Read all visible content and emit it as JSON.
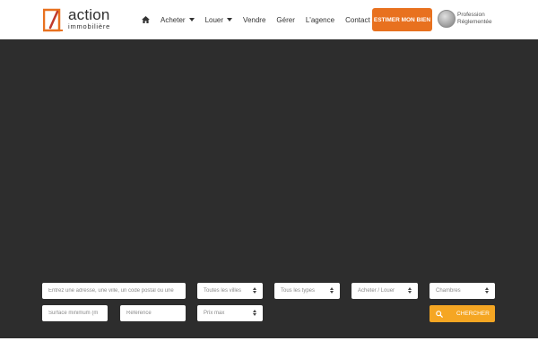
{
  "header": {
    "logo": {
      "line1": "action",
      "line2": "immobilière"
    },
    "nav": [
      {
        "label": "",
        "icon": "home-icon"
      },
      {
        "label": "Acheter",
        "dropdown": true
      },
      {
        "label": "Louer",
        "dropdown": true
      },
      {
        "label": "Vendre",
        "dropdown": false
      },
      {
        "label": "Gérer",
        "dropdown": false
      },
      {
        "label": "L'agence",
        "dropdown": false
      },
      {
        "label": "Contact",
        "dropdown": true
      }
    ],
    "cta_label": "ESTIMER MON BIEN",
    "badge": {
      "line1": "Profession",
      "line2": "Réglementée"
    }
  },
  "search": {
    "address_placeholder": "Entrez une adresse, une ville, un code postal ou une",
    "city_value": "Toutes les villes",
    "type_value": "Tous les types",
    "transaction_value": "Acheter / Louer",
    "rooms_value": "Chambres",
    "surface_placeholder": "Surface minimum (m",
    "reference_placeholder": "Référence",
    "price_value": "Prix max",
    "submit_label": "CHERCHER"
  },
  "colors": {
    "brand_orange": "#e8711f",
    "search_button": "#f5a623",
    "hero_background": "#2d2d2d"
  }
}
